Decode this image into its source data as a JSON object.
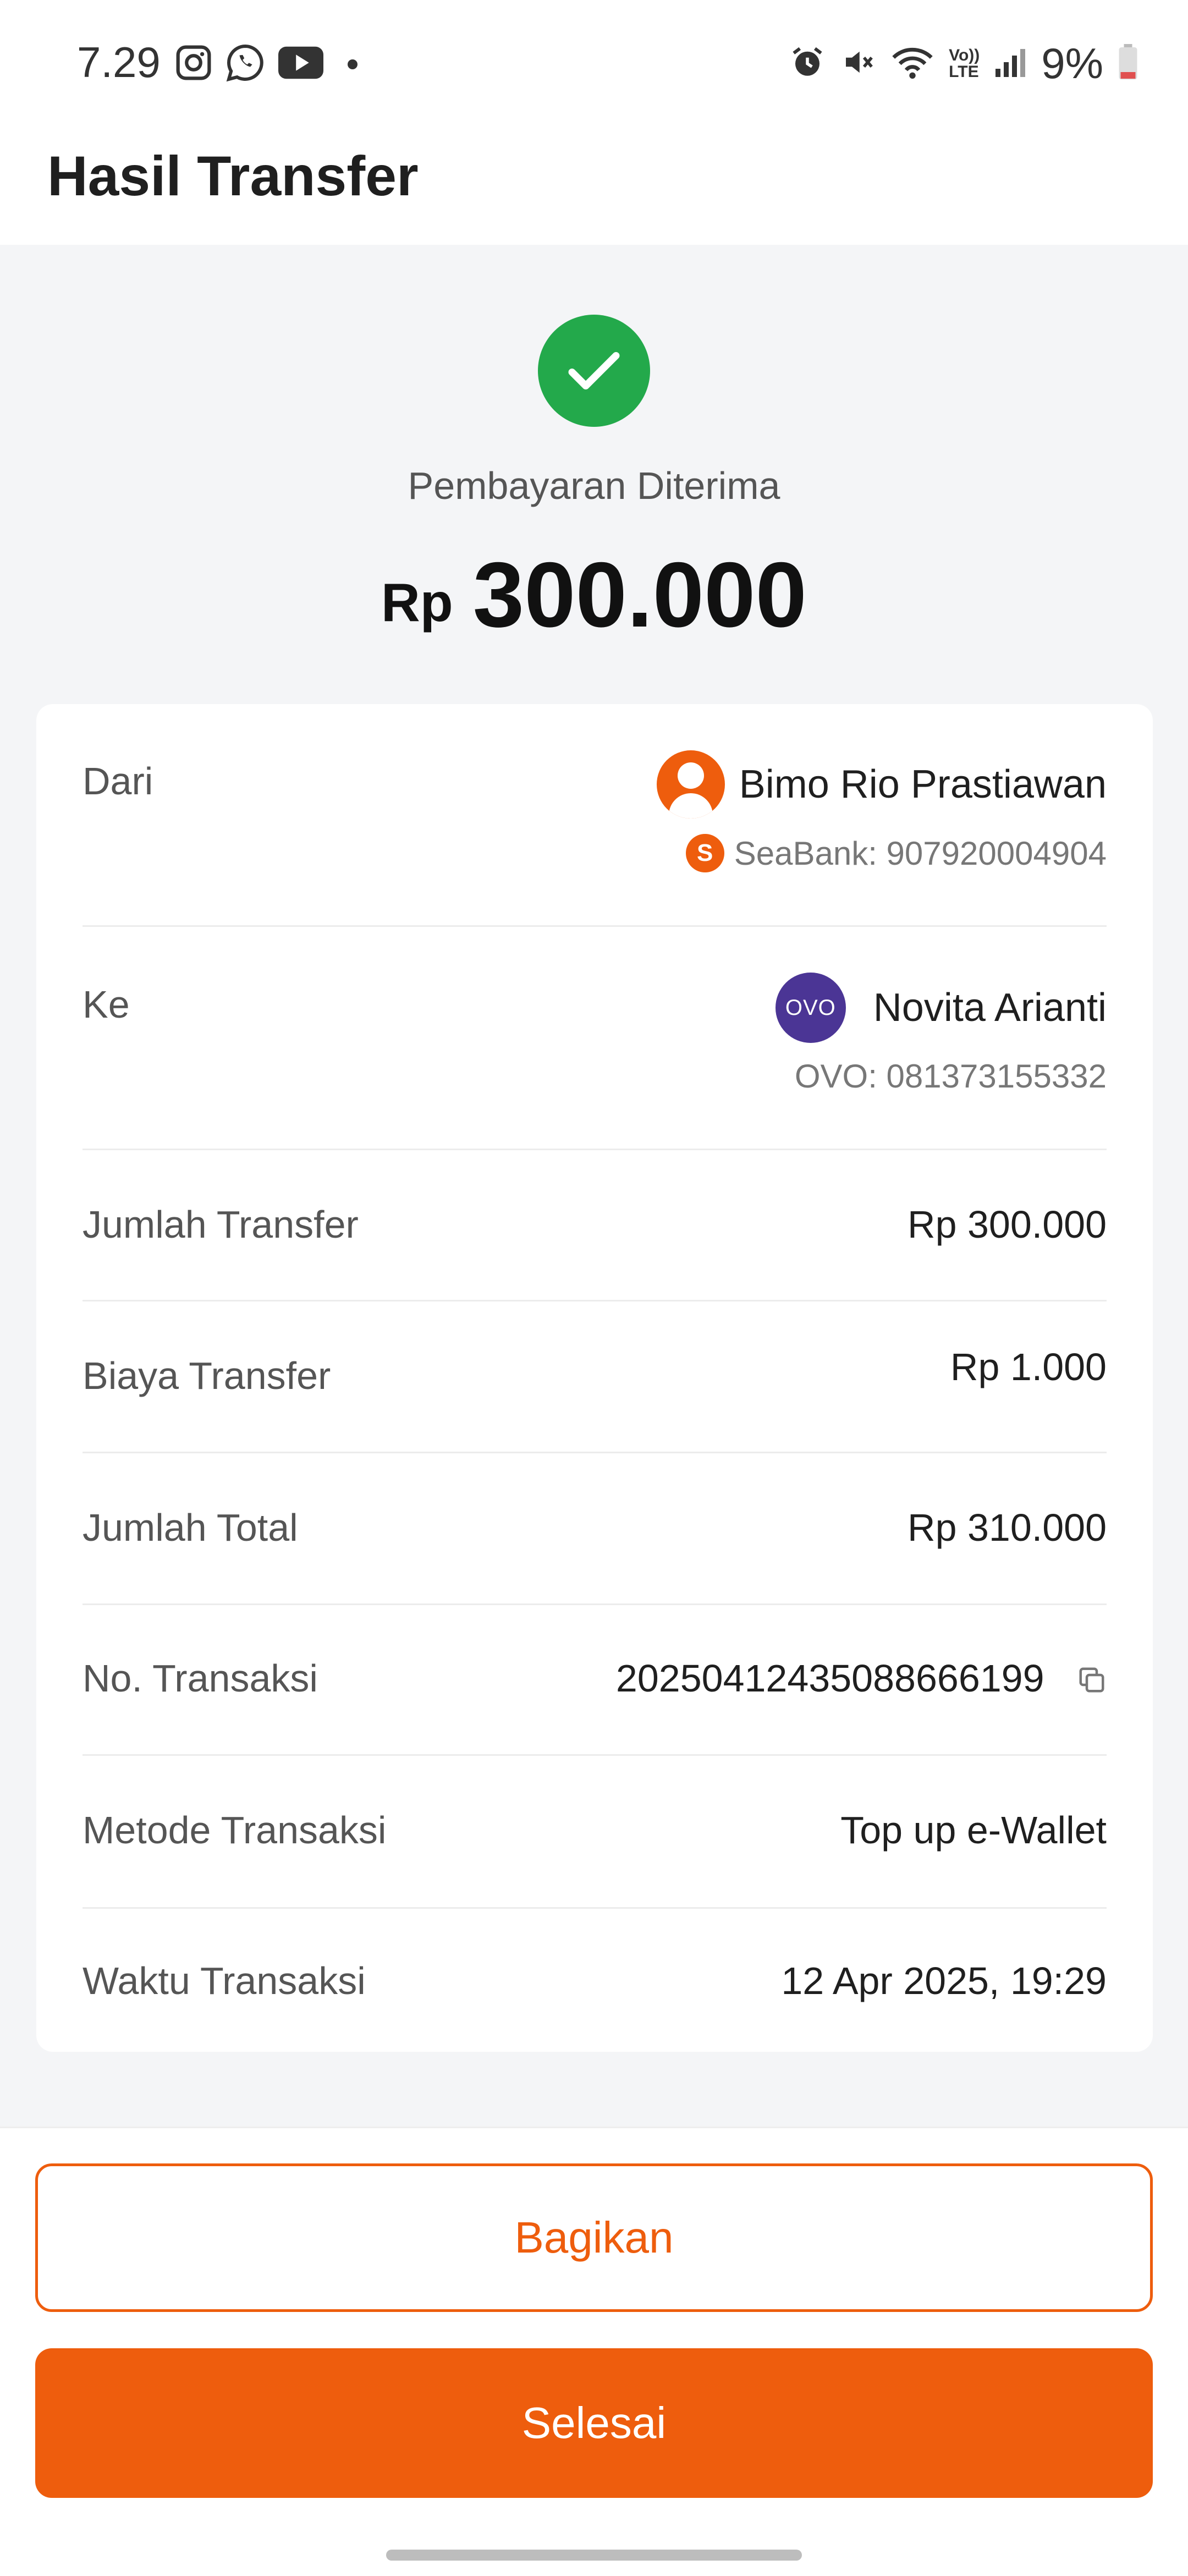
{
  "status_bar": {
    "time": "7.29",
    "battery": "9%",
    "left_icons": [
      "instagram-icon",
      "whatsapp-icon",
      "youtube-icon",
      "notification-dot"
    ],
    "right_icons": [
      "alarm-icon",
      "mute-icon",
      "wifi-icon",
      "volte-icon",
      "signal-icon",
      "battery-icon"
    ],
    "volte_label_top": "Vo))",
    "volte_label_bottom": "LTE"
  },
  "header": {
    "title": "Hasil Transfer"
  },
  "result": {
    "status": "Pembayaran Diterima",
    "currency": "Rp",
    "amount": "300.000",
    "accent_color": "#23a94b"
  },
  "details": {
    "from": {
      "label": "Dari",
      "name": "Bimo Rio Prastiawan",
      "account": "SeaBank: 907920004904",
      "bank_icon_letter": "S"
    },
    "to": {
      "label": "Ke",
      "name": "Novita Arianti",
      "account": "OVO: 081373155332",
      "logo_text": "OVO"
    },
    "rows": [
      {
        "label": "Jumlah Transfer",
        "value": "Rp 300.000"
      },
      {
        "label": "Biaya Transfer",
        "value": "Rp 1.000"
      },
      {
        "label": "Jumlah Total",
        "value": "Rp 310.000"
      },
      {
        "label": "No. Transaksi",
        "value": "20250412435088666199"
      },
      {
        "label": "Metode Transaksi",
        "value": "Top up e-Wallet"
      },
      {
        "label": "Waktu Transaksi",
        "value": "12 Apr 2025, 19:29"
      }
    ]
  },
  "actions": {
    "share_label": "Bagikan",
    "done_label": "Selesai",
    "brand_color": "#ee5d0d"
  }
}
